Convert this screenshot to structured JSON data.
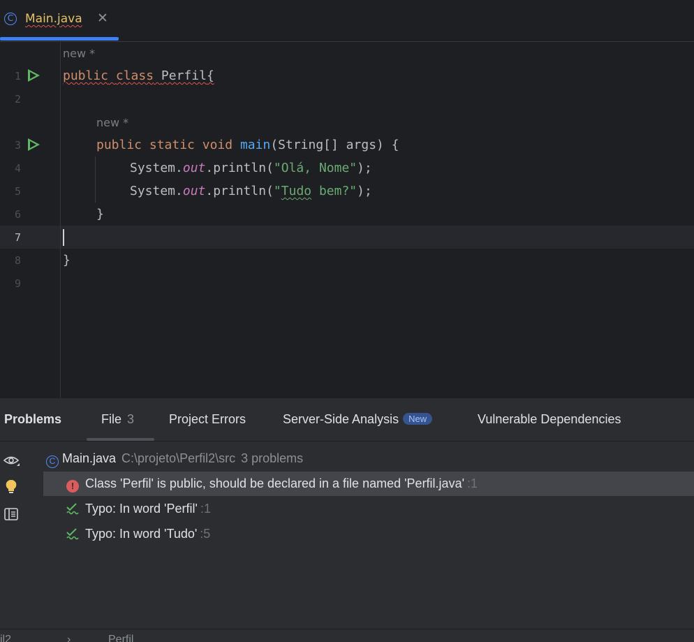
{
  "tab": {
    "label": "Main.java",
    "close": "✕",
    "icon_letter": "C"
  },
  "editor": {
    "hint1": "new *",
    "hint2": "new *",
    "line_numbers": [
      "1",
      "2",
      "3",
      "4",
      "5",
      "6",
      "7",
      "8",
      "9"
    ],
    "code": {
      "l1_kw1": "public",
      "l1_kw2": "class",
      "l1_name": "Perfil",
      "l1_brace": "{",
      "l3_kw1": "public",
      "l3_kw2": "static",
      "l3_kw3": "void",
      "l3_fn": "main",
      "l3_rest": "(String[] args) {",
      "l4_a": "System.",
      "l4_field": "out",
      "l4_b": ".println(",
      "l4_str": "\"Olá, Nome\"",
      "l4_end": ");",
      "l5_a": "System.",
      "l5_field": "out",
      "l5_b": ".println(",
      "l5_str_a": "\"",
      "l5_str_typo": "Tudo",
      "l5_str_b": " bem?\"",
      "l5_end": ");",
      "l6": "}",
      "l8": "}"
    }
  },
  "panel": {
    "tabs": {
      "problems": "Problems",
      "file": "File",
      "file_count": "3",
      "project_errors": "Project Errors",
      "server_side": "Server-Side Analysis",
      "server_side_badge": "New",
      "vulnerable": "Vulnerable Dependencies"
    },
    "file_row": {
      "name": "Main.java",
      "path": "C:\\projeto\\Perfil2\\src",
      "count": "3 problems"
    },
    "problems": [
      {
        "text": "Class 'Perfil' is public, should be declared in a file named 'Perfil.java'",
        "line": ":1",
        "type": "error"
      },
      {
        "text": "Typo: In word 'Perfil'",
        "line": ":1",
        "type": "typo"
      },
      {
        "text": "Typo: In word 'Tudo'",
        "line": ":5",
        "type": "typo"
      }
    ]
  },
  "status": {
    "crumb1": "il2",
    "sep": "›",
    "crumb2": "Perfil"
  },
  "colors": {
    "accent": "#3d7ff5",
    "keyword": "#cf8e6d",
    "string": "#6aab73",
    "function": "#56a8f5",
    "error": "#db5c5c"
  }
}
